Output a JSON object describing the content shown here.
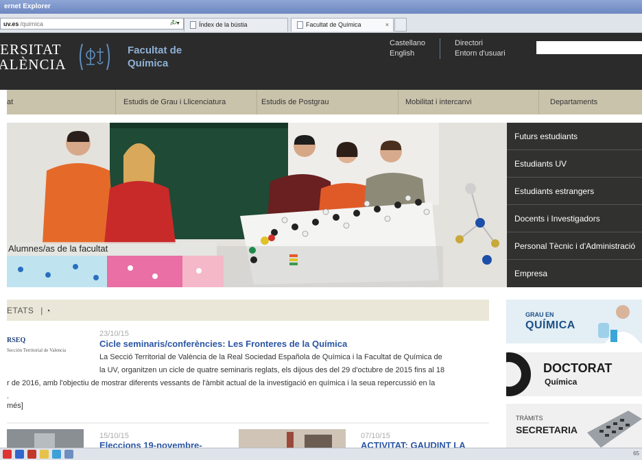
{
  "browser": {
    "title": "ernet Explorer",
    "address_host": "uv.es",
    "address_path": "/quimica",
    "tabs": [
      {
        "label": "Índex de la bústia"
      },
      {
        "label": "Facultat de Química",
        "close": "×"
      }
    ]
  },
  "header": {
    "logo_line1": "VERSITAT",
    "logo_line2": "VALÈNCIA",
    "faculty_line1": "Facultat de",
    "faculty_line2": "Química",
    "lang_links": [
      "Castellano",
      "English"
    ],
    "dir_links": [
      "Directori",
      "Entorn d'usuari"
    ],
    "search_value": ""
  },
  "nav": {
    "items": [
      {
        "label": "at"
      },
      {
        "label": "Estudis de Grau i Llicenciatura"
      },
      {
        "label": "Estudis de Postgrau"
      },
      {
        "label": "Mobilitat i intercanvi"
      },
      {
        "label": "Departaments"
      }
    ]
  },
  "hero": {
    "caption": "Alumnes/as de la facultat"
  },
  "audience": {
    "items": [
      {
        "label": "Futurs estudiants"
      },
      {
        "label": "Estudiants UV"
      },
      {
        "label": "Estudiants estrangers"
      },
      {
        "label": "Docents i Investigadors"
      },
      {
        "label": "Personal Tècnic i d'Administració"
      },
      {
        "label": "Empresa"
      }
    ]
  },
  "news": {
    "header": "ETATS",
    "separator": "|",
    "rss_icon": "rss-icon",
    "rseq_title": "RSEQ",
    "rseq_sub": "Sección Territorial de Valencia",
    "items": [
      {
        "date": "23/10/15",
        "title": "Cicle seminaris/conferències: Les Fronteres de la Química",
        "body_line1": "La Secció Territorial de València de la Real Sociedad Española de Química i la Facultat de Química de",
        "body_line2": "la UV, organitzen un cicle de quatre seminaris reglats, els dijous des del 29 d'octubre de 2015 fins al 18",
        "body_line3": "r de 2016, amb l'objectiu de mostrar diferents vessants de l'àmbit actual de la investigació en química i la seua repercussió en la",
        "body_line4": "."
      },
      {
        "date": "15/10/15",
        "title": "Eleccions 19-novembre-"
      },
      {
        "date": "07/10/15",
        "title": "ACTIVITAT: GAUDINT LA"
      }
    ],
    "more": "més]"
  },
  "banners": {
    "grau_small": "GRAU EN",
    "grau_big": "QUÍMICA",
    "doc_big": "DOCTORAT",
    "doc_small": "Química",
    "sec_small": "TRÀMITS",
    "sec_big": "SECRETARIA"
  },
  "taskbar": {
    "end_text": "65"
  },
  "colors": {
    "header_bg": "#2b2b2b",
    "nav_bg": "#cac3ab",
    "faculty_blue": "#8fb1d6",
    "news_title": "#2a55a4"
  }
}
